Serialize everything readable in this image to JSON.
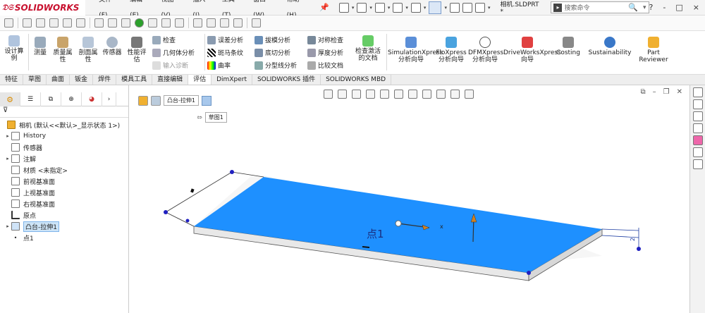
{
  "app": {
    "logo": "SOLIDWORKS",
    "file_name": "相机.SLDPRT *"
  },
  "menus": [
    "文件(F)",
    "编辑(E)",
    "视图(V)",
    "插入(I)",
    "工具(T)",
    "窗口(W)",
    "帮助(H)"
  ],
  "search": {
    "placeholder": "搜索命令"
  },
  "window_controls": [
    "?",
    "-",
    "□",
    "×"
  ],
  "ribbon": {
    "design_calc": "设计算例",
    "measure": "测量",
    "mass_props": "质量属性",
    "section_props": "剖面属性",
    "sensor": "传感器",
    "perf_eval": "性能评估",
    "check": "检查",
    "geometry_analysis": "几何体分析",
    "import_diag": "输入诊断",
    "deviation_analysis": "误差分析",
    "zebra": "斑马条纹",
    "curvature": "曲率",
    "draft_analysis": "拔模分析",
    "undercut_analysis": "底切分析",
    "parting_line": "分型线分析",
    "symmetry_check": "对称检查",
    "thickness_analysis": "厚度分析",
    "compare_docs": "比较文档",
    "check_active_doc": "检查激活的文档",
    "simxpress": "SimulationXpress 分析向导",
    "floxpress": "FloXpress 分析向导",
    "dfmxpress": "DFMXpress 分析向导",
    "driveworks": "DriveWorksXpress 向导",
    "costing": "Costing",
    "sustainability": "Sustainability",
    "part_reviewer": "Part Reviewer"
  },
  "tabs": [
    "特征",
    "草图",
    "曲面",
    "钣金",
    "焊件",
    "模具工具",
    "直接编辑",
    "评估",
    "DimXpert",
    "SOLIDWORKS 插件",
    "SOLIDWORKS MBD"
  ],
  "active_tab": "评估",
  "tree": {
    "root": "相机 (默认<<默认>_显示状态 1>)",
    "items": [
      "History",
      "传感器",
      "注解",
      "材质 <未指定>",
      "前视基准面",
      "上视基准面",
      "右视基准面",
      "原点",
      "凸台-拉伸1",
      "点1"
    ]
  },
  "breadcrumb": {
    "feature": "凸台-拉伸1",
    "sketch": "草图1"
  },
  "canvas": {
    "point_label": "点1",
    "axis_x": "x",
    "dim_small": "2"
  },
  "colors": {
    "top_face": "#1E90FF",
    "accent": "#2b6ec8",
    "logo": "#c8102e"
  }
}
